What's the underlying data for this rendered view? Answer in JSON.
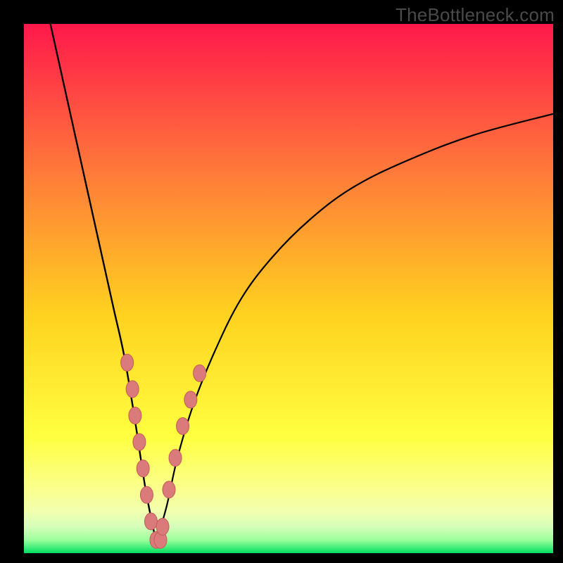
{
  "watermark": "TheBottleneck.com",
  "colors": {
    "frame": "#000000",
    "grad_top": "#ff184b",
    "grad_mid_upper": "#ff7a3a",
    "grad_mid": "#ffd21f",
    "grad_mid_lower": "#ffff40",
    "grad_band1": "#faff8e",
    "grad_band2": "#f2ffae",
    "grad_band3": "#d6ffbb",
    "grad_band4": "#9cff9c",
    "grad_bottom": "#00e060",
    "curve": "#000000",
    "dot_fill": "#db7a7a",
    "dot_stroke": "#c65a5a"
  },
  "chart_data": {
    "type": "line",
    "title": "",
    "xlabel": "",
    "ylabel": "",
    "x_range": [
      0,
      100
    ],
    "y_range": [
      0,
      100
    ],
    "optimum_x": 25,
    "left_curve": [
      [
        5,
        100
      ],
      [
        7,
        91
      ],
      [
        9,
        82
      ],
      [
        11,
        73
      ],
      [
        13,
        64
      ],
      [
        15,
        55
      ],
      [
        17,
        46
      ],
      [
        19,
        37
      ],
      [
        21,
        25
      ],
      [
        23,
        12
      ],
      [
        25,
        2
      ]
    ],
    "right_curve": [
      [
        25,
        2
      ],
      [
        27,
        9
      ],
      [
        29,
        18
      ],
      [
        32,
        28
      ],
      [
        36,
        38
      ],
      [
        41,
        48
      ],
      [
        47,
        56
      ],
      [
        54,
        63
      ],
      [
        62,
        69
      ],
      [
        72,
        74
      ],
      [
        85,
        79
      ],
      [
        100,
        83
      ]
    ],
    "dots": [
      [
        19.5,
        36
      ],
      [
        20.5,
        31
      ],
      [
        21.0,
        26
      ],
      [
        21.8,
        21
      ],
      [
        22.5,
        16
      ],
      [
        23.2,
        11
      ],
      [
        24.0,
        6
      ],
      [
        25.0,
        2.5
      ],
      [
        25.8,
        2.5
      ],
      [
        26.2,
        5
      ],
      [
        27.4,
        12
      ],
      [
        28.6,
        18
      ],
      [
        30.0,
        24
      ],
      [
        31.5,
        29
      ],
      [
        33.2,
        34
      ]
    ]
  }
}
